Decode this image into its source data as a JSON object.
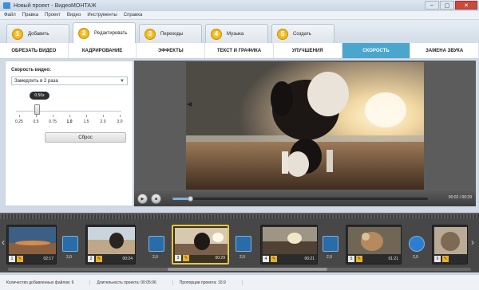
{
  "window": {
    "title": "Новый проект - ВидеоМОНТАЖ",
    "controls": [
      "–",
      "▢",
      "✕"
    ]
  },
  "menu": [
    "Файл",
    "Правка",
    "Проект",
    "Видео",
    "Инструменты",
    "Справка"
  ],
  "steps": [
    {
      "num": "1",
      "label": "Добавить"
    },
    {
      "num": "2",
      "label": "Редактировать",
      "active": true
    },
    {
      "num": "3",
      "label": "Переходы"
    },
    {
      "num": "4",
      "label": "Музыка"
    },
    {
      "num": "5",
      "label": "Создать"
    }
  ],
  "subtabs": [
    {
      "label": "ОБРЕЗАТЬ ВИДЕО"
    },
    {
      "label": "КАДРИРОВАНИЕ"
    },
    {
      "label": "ЭФФЕКТЫ"
    },
    {
      "label": "ТЕКСТ И ГРАФИКА"
    },
    {
      "label": "УЛУЧШЕНИЯ"
    },
    {
      "label": "СКОРОСТЬ",
      "active": true
    },
    {
      "label": "ЗАМЕНА ЗВУКА"
    }
  ],
  "speed": {
    "label": "Скорость видео:",
    "selected": "Замедлить в 2 раза",
    "bubble": "0.50x",
    "ticks": [
      "0.25",
      "0.5",
      "0.75",
      "1.0",
      "1.5",
      "2.0",
      "3.0"
    ],
    "reset": "Сброс"
  },
  "player": {
    "time": "00:02 / 00:29",
    "progress": 0.07
  },
  "timeline": {
    "clips": [
      {
        "num": "1",
        "dur": "02:17"
      },
      {
        "num": "2",
        "dur": "00:24"
      },
      {
        "num": "3",
        "dur": "00:29",
        "active": true
      },
      {
        "num": "4",
        "dur": "00:21"
      },
      {
        "num": "5",
        "dur": "01:21"
      },
      {
        "num": "6",
        "dur": ""
      }
    ],
    "transitions": [
      "2,0",
      "2,0",
      "2,0",
      "2,0",
      "2,0"
    ]
  },
  "status": {
    "files": "Количество добавленных файлов: 6",
    "duration": "Длительность проекта: 00:05:06",
    "ratio": "Пропорции проекта: 16:9"
  },
  "colors": {
    "accent_tab": "#4aa6cc",
    "step_badge": "#ffd24a",
    "active_clip_border": "#e9c640"
  }
}
